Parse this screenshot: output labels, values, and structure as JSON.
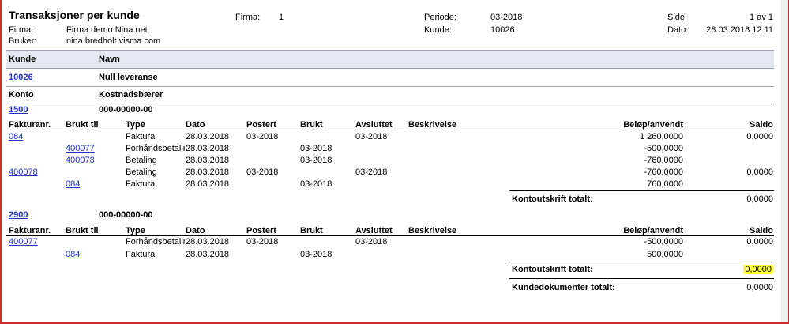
{
  "header": {
    "title": "Transaksjoner per kunde",
    "firma_label": "Firma:",
    "firma_value": "Firma demo Nina.net",
    "bruker_label": "Bruker:",
    "bruker_value": "nina.bredholt.visma.com",
    "firma_no_label": "Firma:",
    "firma_no_value": "1",
    "periode_label": "Periode:",
    "periode_value": "03-2018",
    "kunde_label": "Kunde:",
    "kunde_value": "10026",
    "side_label": "Side:",
    "side_value": "1 av 1",
    "dato_label": "Dato:",
    "dato_value": "28.03.2018 12:11"
  },
  "customer": {
    "kunde_header": "Kunde",
    "navn_header": "Navn",
    "kunde_no": "10026",
    "kunde_navn": "Null leveranse",
    "konto_header": "Konto",
    "kostnad_header": "Kostnadsbærer"
  },
  "columns": {
    "fakturanr": "Fakturanr.",
    "brukt_til": "Brukt til",
    "type": "Type",
    "dato": "Dato",
    "postert": "Postert",
    "brukt": "Brukt",
    "avsluttet": "Avsluttet",
    "beskrivelse": "Beskrivelse",
    "belop": "Beløp/anvendt",
    "saldo": "Saldo"
  },
  "accounts": [
    {
      "konto": "1500",
      "kostnad": "000-00000-00",
      "rows": [
        {
          "fakturanr": "084",
          "brukt_til": "",
          "type": "Faktura",
          "dato": "28.03.2018",
          "postert": "03-2018",
          "brukt": "",
          "avsluttet": "03-2018",
          "belop": "1 260,0000",
          "saldo": "0,0000"
        },
        {
          "fakturanr": "",
          "brukt_til": "400077",
          "type": "Forhåndsbetaling",
          "dato": "28.03.2018",
          "postert": "",
          "brukt": "03-2018",
          "avsluttet": "",
          "belop": "-500,0000",
          "saldo": ""
        },
        {
          "fakturanr": "",
          "brukt_til": "400078",
          "type": "Betaling",
          "dato": "28.03.2018",
          "postert": "",
          "brukt": "03-2018",
          "avsluttet": "",
          "belop": "-760,0000",
          "saldo": ""
        },
        {
          "fakturanr": "400078",
          "brukt_til": "",
          "type": "Betaling",
          "dato": "28.03.2018",
          "postert": "03-2018",
          "brukt": "",
          "avsluttet": "03-2018",
          "belop": "-760,0000",
          "saldo": "0,0000"
        },
        {
          "fakturanr": "",
          "brukt_til": "084",
          "type": "Faktura",
          "dato": "28.03.2018",
          "postert": "",
          "brukt": "03-2018",
          "avsluttet": "",
          "belop": "760,0000",
          "saldo": ""
        }
      ],
      "total_label": "Kontoutskrift totalt:",
      "total_value": "0,0000"
    },
    {
      "konto": "2900",
      "kostnad": "000-00000-00",
      "rows": [
        {
          "fakturanr": "400077",
          "brukt_til": "",
          "type": "Forhåndsbetaling",
          "dato": "28.03.2018",
          "postert": "03-2018",
          "brukt": "",
          "avsluttet": "03-2018",
          "belop": "-500,0000",
          "saldo": "0,0000"
        },
        {
          "fakturanr": "",
          "brukt_til": "084",
          "type": "Faktura",
          "dato": "28.03.2018",
          "postert": "",
          "brukt": "03-2018",
          "avsluttet": "",
          "belop": "500,0000",
          "saldo": ""
        }
      ],
      "total_label": "Kontoutskrift totalt:",
      "total_value": "0,0000"
    }
  ],
  "grand_total_label": "Kundedokumenter totalt:",
  "grand_total_value": "0,0000",
  "highlight_color": "#ffff3c",
  "link_color": "#1f35c8"
}
